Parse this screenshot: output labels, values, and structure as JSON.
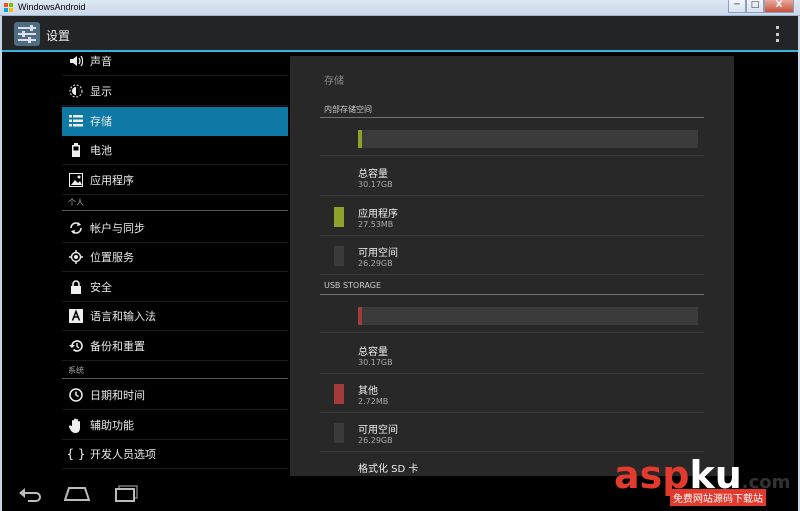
{
  "window": {
    "title": "WindowsAndroid",
    "controls": [
      "─",
      "□",
      "X"
    ]
  },
  "action_bar": {
    "title": "设置"
  },
  "sidebar": {
    "items": [
      {
        "label": "声音",
        "icon": "speaker-icon"
      },
      {
        "label": "显示",
        "icon": "brightness-icon"
      },
      {
        "label": "存储",
        "icon": "storage-icon",
        "selected": true
      },
      {
        "label": "电池",
        "icon": "battery-icon"
      },
      {
        "label": "应用程序",
        "icon": "apps-icon"
      }
    ],
    "sections": [
      {
        "header": "个人",
        "items": [
          {
            "label": "帐户与同步",
            "icon": "sync-icon"
          },
          {
            "label": "位置服务",
            "icon": "location-icon"
          },
          {
            "label": "安全",
            "icon": "lock-icon"
          },
          {
            "label": "语言和输入法",
            "icon": "keyboard-icon"
          },
          {
            "label": "备份和重置",
            "icon": "backup-icon"
          }
        ]
      },
      {
        "header": "系统",
        "items": [
          {
            "label": "日期和时间",
            "icon": "clock-icon"
          },
          {
            "label": "辅助功能",
            "icon": "hand-icon"
          },
          {
            "label": "开发人员选项",
            "icon": "braces-icon"
          }
        ]
      }
    ]
  },
  "storage": {
    "title": "存储",
    "internal": {
      "header": "内部存储空间",
      "bar": {
        "fraction": 0.009,
        "color": "#8ea12a"
      },
      "rows": [
        {
          "title": "总容量",
          "value": "30.17GB",
          "swatch": null
        },
        {
          "title": "应用程序",
          "value": "27.53MB",
          "swatch": "#8ea12a"
        },
        {
          "title": "可用空间",
          "value": "26.29GB",
          "swatch": "#3a3a3a"
        }
      ]
    },
    "usb": {
      "header": "USB STORAGE",
      "bar": {
        "fraction": 0.008,
        "color": "#a33a3a"
      },
      "rows": [
        {
          "title": "总容量",
          "value": "30.17GB",
          "swatch": null
        },
        {
          "title": "其他",
          "value": "2.72MB",
          "swatch": "#a33a3a"
        },
        {
          "title": "可用空间",
          "value": "26.29GB",
          "swatch": "#3a3a3a"
        }
      ]
    },
    "format_label": "格式化 SD 卡"
  },
  "watermark": {
    "brand_a": "asp",
    "brand_b": "ku",
    "brand_c": ".com",
    "tagline": "免费网站源码下载站"
  },
  "colors": {
    "accent": "#33b5e5",
    "selected": "#0f79a6"
  }
}
